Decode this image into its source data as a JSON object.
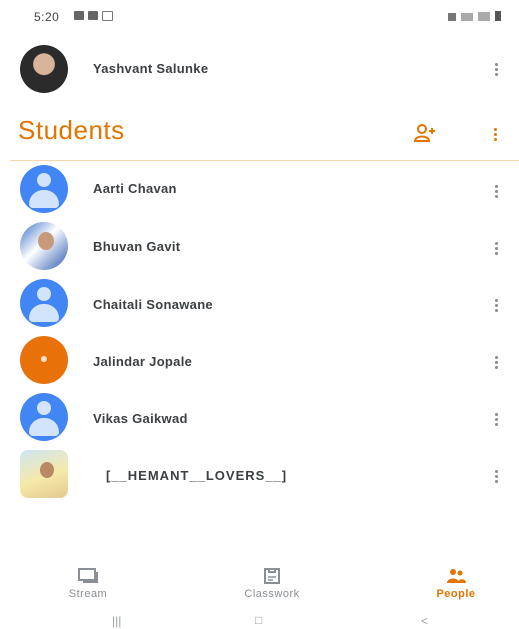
{
  "status_bar": {
    "time": "5:20",
    "left_icons": [
      "image-icon",
      "calendar-icon",
      "gallery-icon"
    ],
    "right_icons": [
      "mute-icon",
      "signal-icon",
      "wifi-icon",
      "battery-icon"
    ]
  },
  "teacher": {
    "name": "Yashvant Salunke",
    "avatar": "photo-avatar"
  },
  "students_section": {
    "title": "Students",
    "add_icon": "add-person-icon",
    "more_icon": "more-vert-icon"
  },
  "students": [
    {
      "name": "Aarti Chavan",
      "avatar": "default-avatar"
    },
    {
      "name": "Bhuvan Gavit",
      "avatar": "photo-avatar"
    },
    {
      "name": "Chaitali Sonawane",
      "avatar": "default-avatar"
    },
    {
      "name": "Jalindar Jopale",
      "avatar": "orange-avatar"
    },
    {
      "name": "Vikas Gaikwad",
      "avatar": "default-avatar"
    },
    {
      "name": "[__HEMANT__LOVERS__]",
      "avatar": "photo-avatar"
    }
  ],
  "bottom_nav": {
    "items": [
      {
        "label": "Stream",
        "icon": "stream-icon",
        "active": false
      },
      {
        "label": "Classwork",
        "icon": "classwork-icon",
        "active": false
      },
      {
        "label": "People",
        "icon": "people-icon",
        "active": true
      }
    ]
  },
  "colors": {
    "accent": "#e37400",
    "default_avatar": "#4285f4",
    "orange_avatar": "#e8710a"
  }
}
